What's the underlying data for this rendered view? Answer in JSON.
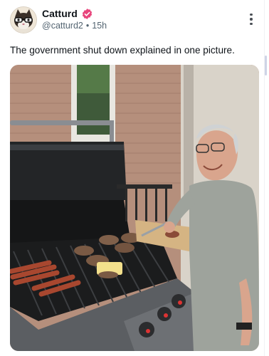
{
  "author": {
    "display_name": "Catturd",
    "handle": "@catturd2",
    "separator": "•",
    "time_ago": "15h",
    "verified": true,
    "verified_color": "#e8457c"
  },
  "post": {
    "text": "The government shut down explained in one picture."
  },
  "icons": {
    "avatar": "cat-with-glasses-avatar",
    "verified": "verified-badge-icon",
    "more": "more-options-icon"
  },
  "colors": {
    "text": "#0f1419",
    "secondary_text": "#536471",
    "verified_badge": "#e8457c"
  }
}
